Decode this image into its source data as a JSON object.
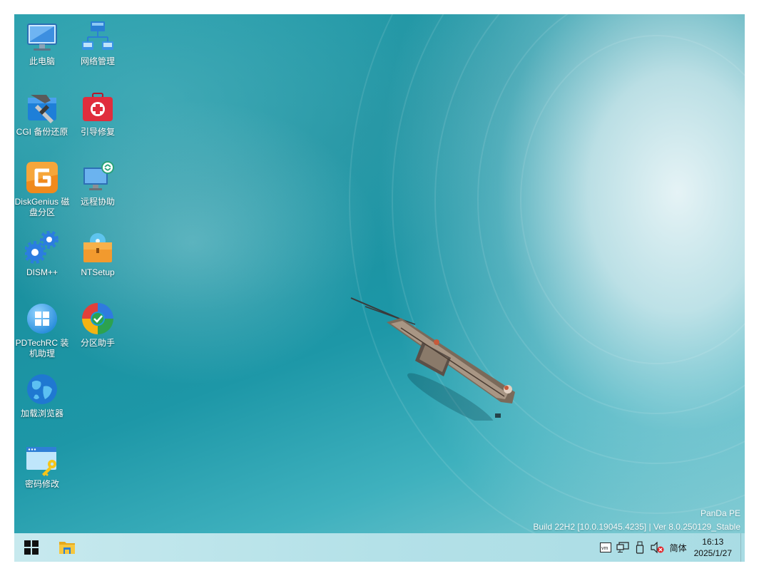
{
  "desktop": {
    "icons": [
      {
        "label": "此电脑",
        "icon": "computer-icon"
      },
      {
        "label": "网络管理",
        "icon": "network-icon"
      },
      {
        "label": "CGI 备份还原",
        "icon": "backup-tools-icon"
      },
      {
        "label": "引导修复",
        "icon": "repair-kit-icon"
      },
      {
        "label": "DiskGenius 磁盘分区",
        "icon": "diskgenius-icon"
      },
      {
        "label": "远程协助",
        "icon": "remote-assist-icon"
      },
      {
        "label": "DISM++",
        "icon": "gears-icon"
      },
      {
        "label": "NTSetup",
        "icon": "setup-package-icon"
      },
      {
        "label": "PDTechRC 装机助理",
        "icon": "windows-logo-icon"
      },
      {
        "label": "分区助手",
        "icon": "partition-assistant-icon"
      },
      {
        "label": "加载浏览器",
        "icon": "globe-icon"
      },
      {
        "label": "密码修改",
        "icon": "password-key-icon"
      }
    ],
    "watermark": {
      "line1": "PanDa  PE",
      "line2": "Build  22H2  [10.0.19045.4235]  |  Ver  8.0.250129_Stable"
    }
  },
  "taskbar": {
    "start_icon": "windows-start-icon",
    "pinned": [
      {
        "icon": "file-explorer-icon"
      }
    ],
    "tray": {
      "icons": [
        "vm-icon",
        "network-monitor-icon",
        "usb-drive-icon",
        "speaker-muted-icon"
      ],
      "ime": "简体",
      "time": "16:13",
      "date": "2025/1/27"
    }
  },
  "colors": {
    "water": "#1d97a7",
    "taskbar": "#b4e1e8",
    "label_text": "#ffffff"
  }
}
